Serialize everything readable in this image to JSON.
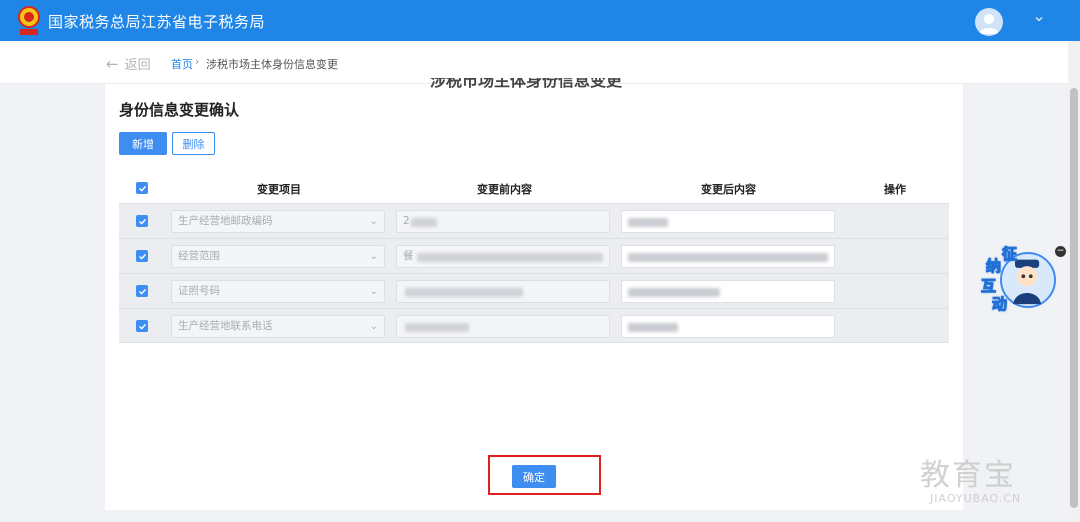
{
  "header": {
    "site_title": "国家税务总局江苏省电子税务局",
    "brand_color": "#1f86e8",
    "emblem_icon": "tax-emblem-icon",
    "avatar_icon": "user-avatar-icon"
  },
  "breadcrumb": {
    "back_label": "返回",
    "home": "首页",
    "separator": "›",
    "current": "涉税市场主体身份信息变更"
  },
  "page": {
    "ghost_title": "涉税市场主体身份信息变更",
    "section_title": "身份信息变更确认",
    "add_label": "新增",
    "delete_label": "删除",
    "confirm_label": "确定"
  },
  "table": {
    "columns": [
      "变更项目",
      "变更前内容",
      "变更后内容",
      "操作"
    ],
    "rows": [
      {
        "item": "生产经营地邮政编码",
        "before": "2",
        "after": ""
      },
      {
        "item": "经营范围",
        "before": "餐",
        "after": ""
      },
      {
        "item": "证照号码",
        "before": "",
        "after": ""
      },
      {
        "item": "生产经营地联系电话",
        "before": "",
        "after": ""
      }
    ]
  },
  "widget": {
    "chars": [
      "征",
      "纳",
      "互",
      "动"
    ]
  },
  "watermark": {
    "big": "教育宝",
    "small": "JIAOYUBAO.CN"
  }
}
